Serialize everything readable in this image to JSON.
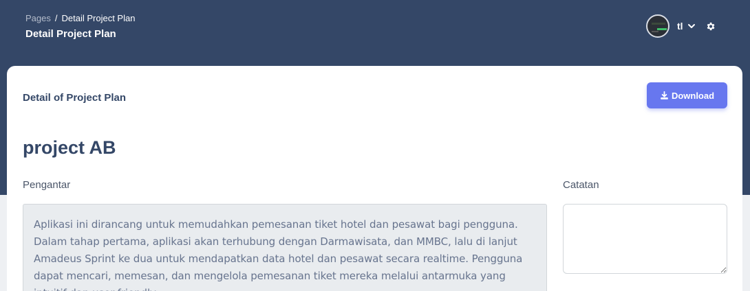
{
  "breadcrumb": {
    "root": "Pages",
    "separator": "/",
    "current": "Detail Project Plan"
  },
  "page_title": "Detail Project Plan",
  "user": {
    "name": "tl",
    "avatar_icon": "user-avatar",
    "chevron_icon": "chevron-down-icon",
    "settings_icon": "gear-icon"
  },
  "card": {
    "heading": "Detail of Project Plan",
    "download_label": "Download",
    "project_name": "project AB",
    "intro_label": "Pengantar",
    "intro_text": "Aplikasi ini dirancang untuk memudahkan pemesanan tiket hotel dan pesawat bagi pengguna. Dalam tahap pertama, aplikasi akan terhubung dengan Darmawisata, dan MMBC, lalu di lanjut Amadeus Sprint ke dua untuk mendapatkan data hotel dan pesawat secara realtime. Pengguna dapat mencari, memesan, dan mengelola pemesanan tiket mereka melalui antarmuka yang intuitif dan user-friendly.",
    "notes_label": "Catatan",
    "notes_value": ""
  },
  "colors": {
    "header": "#344767",
    "accent": "#6777ef",
    "card": "#ffffff"
  }
}
